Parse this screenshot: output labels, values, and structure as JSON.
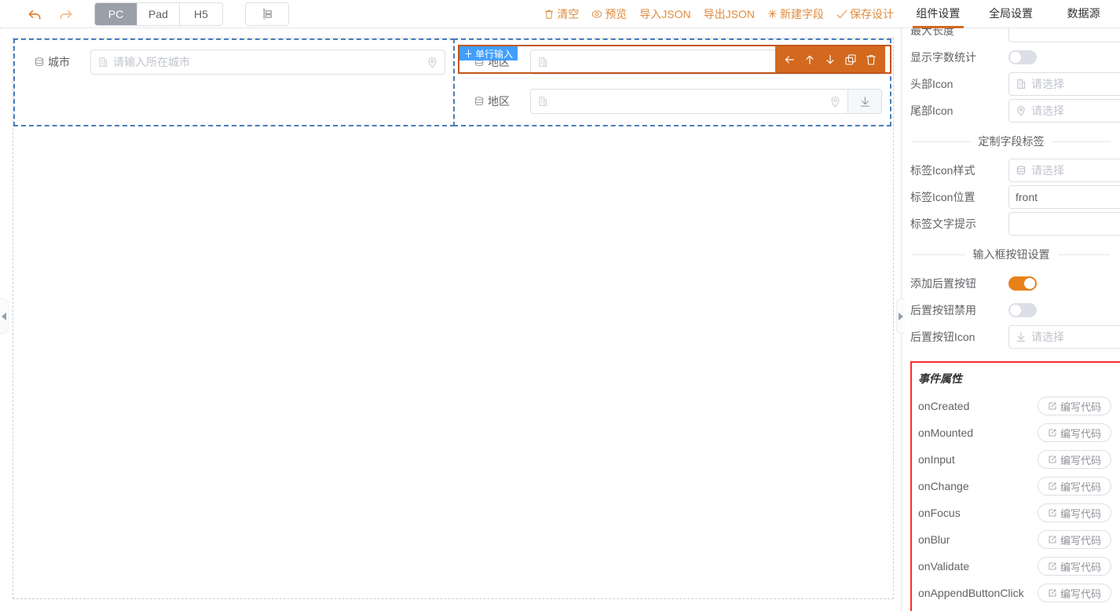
{
  "toolbar": {
    "undo": "undo",
    "redo": "redo",
    "devices": [
      {
        "label": "PC",
        "active": true
      },
      {
        "label": "Pad",
        "active": false
      },
      {
        "label": "H5",
        "active": false
      }
    ],
    "layout_button": "layout",
    "actions": [
      {
        "label": "清空",
        "icon": "trash-icon"
      },
      {
        "label": "预览",
        "icon": "eye-icon"
      },
      {
        "label": "导入JSON",
        "icon": "none"
      },
      {
        "label": "导出JSON",
        "icon": "none"
      },
      {
        "label": "新建字段",
        "icon": "sparkle-icon"
      },
      {
        "label": "保存设计",
        "icon": "check-icon"
      }
    ],
    "accent_color": "#e08b3d"
  },
  "right_tabs": [
    {
      "label": "组件设置",
      "active": true
    },
    {
      "label": "全局设置",
      "active": false
    },
    {
      "label": "数据源",
      "active": false
    }
  ],
  "canvas": {
    "col1": {
      "field": {
        "label": "城市",
        "label_icon": "database-icon",
        "prefix_icon": "building-icon",
        "placeholder": "请输入所在城市",
        "suffix_icon": "location-pin-icon",
        "value": ""
      }
    },
    "col2": {
      "selected_field": {
        "badge": "单行输入",
        "badge_icon": "drag-handle-icon",
        "label": "地区",
        "label_icon": "database-icon",
        "prefix_icon": "building-icon",
        "placeholder": "",
        "value": "",
        "tools": [
          {
            "name": "move-left-icon",
            "glyph": "←"
          },
          {
            "name": "move-up-icon",
            "glyph": "↑"
          },
          {
            "name": "move-down-icon",
            "glyph": "↓"
          },
          {
            "name": "copy-icon",
            "glyph": "copy"
          },
          {
            "name": "delete-icon",
            "glyph": "trash"
          }
        ]
      },
      "field": {
        "label": "地区",
        "label_icon": "database-icon",
        "prefix_icon": "building-icon",
        "placeholder": "",
        "suffix_icon": "location-pin-icon",
        "append_button_icon": "download-icon",
        "value": ""
      }
    }
  },
  "panel": {
    "rows": [
      {
        "type": "input",
        "label": "最大长度",
        "value": ""
      },
      {
        "type": "switch",
        "label": "显示字数统计",
        "on": false
      },
      {
        "type": "select",
        "label": "头部Icon",
        "icon": "building-icon",
        "placeholder": "请选择",
        "value": ""
      },
      {
        "type": "select",
        "label": "尾部Icon",
        "icon": "location-pin-icon",
        "placeholder": "请选择",
        "value": ""
      },
      {
        "type": "divider",
        "label": "定制字段标签"
      },
      {
        "type": "select",
        "label": "标签Icon样式",
        "icon": "database-icon",
        "placeholder": "请选择",
        "value": ""
      },
      {
        "type": "select",
        "label": "标签Icon位置",
        "icon": "none",
        "placeholder": "",
        "value": "front"
      },
      {
        "type": "input",
        "label": "标签文字提示",
        "value": ""
      },
      {
        "type": "divider",
        "label": "输入框按钮设置"
      },
      {
        "type": "switch",
        "label": "添加后置按钮",
        "on": true
      },
      {
        "type": "switch",
        "label": "后置按钮禁用",
        "on": false
      },
      {
        "type": "select",
        "label": "后置按钮Icon",
        "icon": "download-icon",
        "placeholder": "请选择",
        "value": ""
      }
    ],
    "events": {
      "title": "事件属性",
      "button_label": "编写代码",
      "button_icon": "edit-code-icon",
      "highlight_color": "#ff2a2a",
      "items": [
        "onCreated",
        "onMounted",
        "onInput",
        "onChange",
        "onFocus",
        "onBlur",
        "onValidate",
        "onAppendButtonClick"
      ]
    }
  }
}
